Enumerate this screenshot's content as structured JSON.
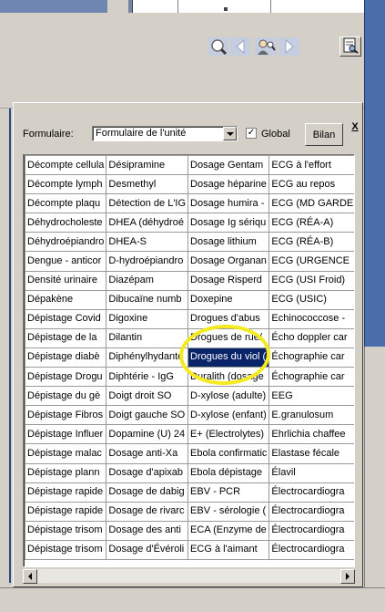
{
  "form": {
    "label": "Formulaire:",
    "combo_value": "Formulaire de l'unité",
    "global_label": "Global",
    "global_checked_mark": "✓",
    "bilan_label": "Bilan",
    "close_label": "X"
  },
  "grid": {
    "rows": [
      [
        "Décompte cellula",
        "Désipramine",
        "Dosage Gentam",
        "ECG à l'effort"
      ],
      [
        "Décompte lymph",
        "Desmethyl",
        "Dosage héparine",
        "ECG au repos"
      ],
      [
        "Décompte plaqu",
        "Détection de L'IG",
        "Dosage humira -",
        "ECG (MD GARDE"
      ],
      [
        "Déhydrocholeste",
        "DHEA (déhydroé",
        "Dosage Ig sériqu",
        "ECG (RÉA-A)"
      ],
      [
        "Déhydroépiandro",
        "DHEA-S",
        "Dosage lithium",
        "ECG (RÉA-B)"
      ],
      [
        "Dengue - anticor",
        "D-hydroépiandro",
        "Dosage Organan",
        "ECG (URGENCE"
      ],
      [
        "Densité urinaire",
        "Diazépam",
        "Dosage Risperd",
        "ECG (USI Froid)"
      ],
      [
        "Dépakène",
        "Dibucaïne numb",
        "Doxepine",
        "ECG (USIC)"
      ],
      [
        "Dépistage Covid",
        "Digoxine",
        "Drogues d'abus",
        "Echinococcose -"
      ],
      [
        "Dépistage de la",
        "Dilantin",
        "Drogues de rue/",
        "Écho doppler car"
      ],
      [
        "Dépistage diabè",
        "Diphénylhydanto",
        "Drogues du viol (",
        "Échographie car"
      ],
      [
        "Dépistage Drogu",
        "Diphtérie - IgG",
        "Duralith (dosage",
        "Échographie car"
      ],
      [
        "Dépistage du gè",
        "Doigt droit SO",
        "D-xylose (adulte)",
        "EEG"
      ],
      [
        "Dépistage Fibros",
        "Doigt gauche SO",
        "D-xylose (enfant)",
        "E.granulosum"
      ],
      [
        "Dépistage Influer",
        "Dopamine (U) 24",
        "E+ (Electrolytes)",
        "Ehrlichia chaffee"
      ],
      [
        "Dépistage malac",
        "Dosage anti-Xa",
        "Ebola confirmatic",
        "Elastase fécale"
      ],
      [
        "Dépistage plann",
        "Dosage d'apixab",
        "Ebola dépistage",
        "Élavil"
      ],
      [
        "Dépistage rapide",
        "Dosage de dabig",
        "EBV - PCR",
        "Électrocardiogra"
      ],
      [
        "Dépistage rapide",
        "Dosage de rivarc",
        "EBV - sérologie (",
        "Électrocardiogra"
      ],
      [
        "Dépistage trisom",
        "Dosage des anti",
        "ECA (Enzyme de",
        "Électrocardiogra"
      ],
      [
        "Dépistage trisom",
        "Dosage d'Évéroli",
        "ECG à l'aimant",
        "Électrocardiogra"
      ]
    ],
    "selected_cell": "Drogues du viol ("
  },
  "colors": {
    "selection": "#0a246a",
    "highlight_circle": "#f4ea1f",
    "window_blue": "#4a6ea9"
  },
  "icons": [
    "search-icon",
    "back-arrow-icon",
    "person-search-icon",
    "forward-arrow-icon",
    "print-preview-icon",
    "chevron-down-icon",
    "scroll-left-icon",
    "scroll-right-icon"
  ]
}
